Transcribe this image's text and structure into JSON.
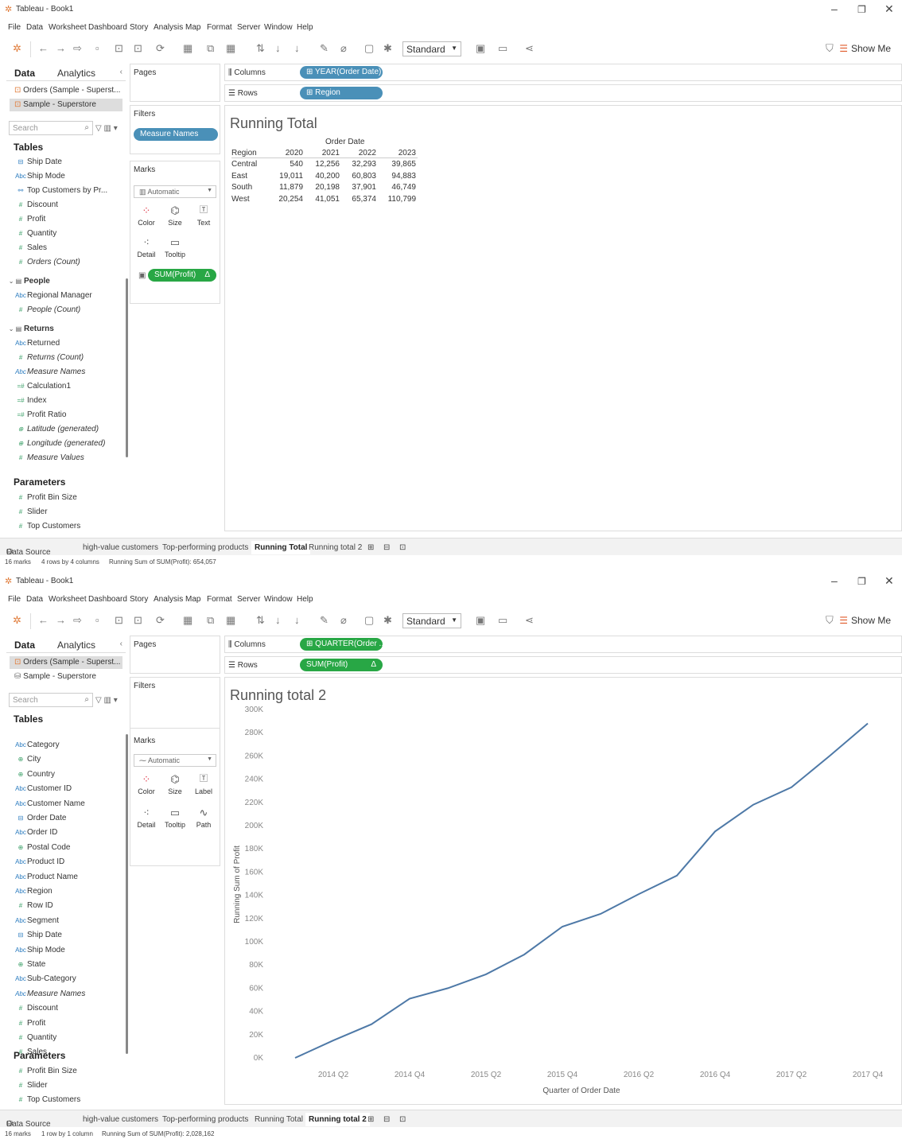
{
  "windows": [
    {
      "title": "Tableau - Book1",
      "menu": [
        "File",
        "Data",
        "Worksheet",
        "Dashboard",
        "Story",
        "Analysis",
        "Map",
        "Format",
        "Server",
        "Window",
        "Help"
      ],
      "toolbar": {
        "fit": "Standard",
        "show_me": "Show Me"
      },
      "left": {
        "tab_data": "Data",
        "tab_analytics": "Analytics",
        "datasources": [
          "Orders (Sample - Superst...",
          "Sample - Superstore"
        ],
        "search_placeholder": "Search",
        "tables_label": "Tables",
        "items": [
          {
            "icon": "date",
            "name": "Ship Date",
            "italic": false
          },
          {
            "icon": "abc",
            "name": "Ship Mode",
            "italic": false
          },
          {
            "icon": "set",
            "name": "Top Customers by Pr...",
            "italic": false
          },
          {
            "icon": "num",
            "name": "Discount",
            "italic": false
          },
          {
            "icon": "num",
            "name": "Profit",
            "italic": false
          },
          {
            "icon": "num",
            "name": "Quantity",
            "italic": false
          },
          {
            "icon": "num",
            "name": "Sales",
            "italic": false
          },
          {
            "icon": "num",
            "name": "Orders (Count)",
            "italic": true
          },
          {
            "icon": "group",
            "name": "People",
            "italic": false,
            "bold": true
          },
          {
            "icon": "abc",
            "name": "Regional Manager",
            "italic": false
          },
          {
            "icon": "num",
            "name": "People (Count)",
            "italic": true
          },
          {
            "icon": "group",
            "name": "Returns",
            "italic": false,
            "bold": true
          },
          {
            "icon": "abc",
            "name": "Returned",
            "italic": false
          },
          {
            "icon": "num",
            "name": "Returns (Count)",
            "italic": true
          },
          {
            "icon": "abc",
            "name": "Measure Names",
            "italic": true
          },
          {
            "icon": "calc",
            "name": "Calculation1",
            "italic": false
          },
          {
            "icon": "calc",
            "name": "Index",
            "italic": false
          },
          {
            "icon": "calc",
            "name": "Profit Ratio",
            "italic": false
          },
          {
            "icon": "geo",
            "name": "Latitude (generated)",
            "italic": true
          },
          {
            "icon": "geo",
            "name": "Longitude (generated)",
            "italic": true
          },
          {
            "icon": "num",
            "name": "Measure Values",
            "italic": true
          }
        ],
        "parameters_label": "Parameters",
        "parameters": [
          "Profit Bin Size",
          "Slider",
          "Top Customers"
        ]
      },
      "pages_label": "Pages",
      "filters_label": "Filters",
      "filter_pill": "Measure Names",
      "marks_label": "Marks",
      "marks_type": "Automatic",
      "mark_buttons": [
        "Color",
        "Size",
        "Text",
        "Detail",
        "Tooltip"
      ],
      "mark_pill": "SUM(Profit)",
      "mark_pill_delta": "Δ",
      "columns_label": "Columns",
      "columns_pill": "YEAR(Order Date)",
      "rows_label": "Rows",
      "rows_pill": "Region",
      "sheet_title": "Running Total",
      "table": {
        "col_header": "Order Date",
        "row_header": "Region",
        "years": [
          "2020",
          "2021",
          "2022",
          "2023"
        ],
        "rows": [
          {
            "region": "Central",
            "values": [
              "540",
              "12,256",
              "32,293",
              "39,865"
            ]
          },
          {
            "region": "East",
            "values": [
              "19,011",
              "40,200",
              "60,803",
              "94,883"
            ]
          },
          {
            "region": "South",
            "values": [
              "11,879",
              "20,198",
              "37,901",
              "46,749"
            ]
          },
          {
            "region": "West",
            "values": [
              "20,254",
              "41,051",
              "65,374",
              "110,799"
            ]
          }
        ]
      },
      "tabs": [
        "Data Source",
        "high-value customers",
        "Top-performing products",
        "Running Total",
        "Running total 2"
      ],
      "active_tab": "Running Total",
      "status": [
        "16 marks",
        "4 rows by 4 columns",
        "Running Sum of SUM(Profit): 654,057"
      ]
    },
    {
      "title": "Tableau - Book1",
      "left": {
        "datasources": [
          "Orders (Sample - Superst...",
          "Sample - Superstore"
        ],
        "items": [
          {
            "icon": "abc",
            "name": "Category"
          },
          {
            "icon": "geo",
            "name": "City"
          },
          {
            "icon": "geo",
            "name": "Country"
          },
          {
            "icon": "abc",
            "name": "Customer ID"
          },
          {
            "icon": "abc",
            "name": "Customer Name"
          },
          {
            "icon": "date",
            "name": "Order Date"
          },
          {
            "icon": "abc",
            "name": "Order ID"
          },
          {
            "icon": "geo",
            "name": "Postal Code"
          },
          {
            "icon": "abc",
            "name": "Product ID"
          },
          {
            "icon": "abc",
            "name": "Product Name"
          },
          {
            "icon": "abc",
            "name": "Region"
          },
          {
            "icon": "num",
            "name": "Row ID"
          },
          {
            "icon": "abc",
            "name": "Segment"
          },
          {
            "icon": "date",
            "name": "Ship Date"
          },
          {
            "icon": "abc",
            "name": "Ship Mode"
          },
          {
            "icon": "geo",
            "name": "State"
          },
          {
            "icon": "abc",
            "name": "Sub-Category"
          },
          {
            "icon": "abc",
            "name": "Measure Names",
            "italic": true
          },
          {
            "icon": "num",
            "name": "Discount"
          },
          {
            "icon": "num",
            "name": "Profit"
          },
          {
            "icon": "num",
            "name": "Quantity"
          },
          {
            "icon": "num",
            "name": "Sales"
          }
        ]
      },
      "mark_buttons": [
        "Color",
        "Size",
        "Label",
        "Detail",
        "Tooltip",
        "Path"
      ],
      "columns_pill": "QUARTER(Order ...",
      "rows_pill": "SUM(Profit)",
      "sheet_title": "Running total 2",
      "active_tab": "Running total 2",
      "status": [
        "16 marks",
        "1 row by 1 column",
        "Running Sum of SUM(Profit): 2,028,162"
      ]
    }
  ],
  "chart_data": {
    "type": "line",
    "title": "",
    "xlabel": "Quarter of Order Date",
    "ylabel": "Running Sum of Profit",
    "x_tick_labels": [
      "2014 Q2",
      "2014 Q4",
      "2015 Q2",
      "2015 Q4",
      "2016 Q2",
      "2016 Q4",
      "2017 Q2",
      "2017 Q4"
    ],
    "y_tick_labels": [
      "0K",
      "20K",
      "40K",
      "60K",
      "80K",
      "100K",
      "120K",
      "140K",
      "160K",
      "180K",
      "200K",
      "220K",
      "240K",
      "260K",
      "280K",
      "300K"
    ],
    "ylim": [
      0,
      300000
    ],
    "x": [
      "2014 Q1",
      "2014 Q2",
      "2014 Q3",
      "2014 Q4",
      "2015 Q1",
      "2015 Q2",
      "2015 Q3",
      "2015 Q4",
      "2016 Q1",
      "2016 Q2",
      "2016 Q3",
      "2016 Q4",
      "2017 Q1",
      "2017 Q2",
      "2017 Q3",
      "2017 Q4"
    ],
    "values": [
      0,
      15000,
      29000,
      51000,
      60000,
      72000,
      89000,
      113000,
      124000,
      141000,
      157000,
      195000,
      218000,
      233000,
      260000,
      288000
    ],
    "color": "#4e79a7"
  },
  "colors": {
    "pill_blue": "#4a90b8",
    "pill_green": "#28a745",
    "line": "#4e79a7"
  }
}
